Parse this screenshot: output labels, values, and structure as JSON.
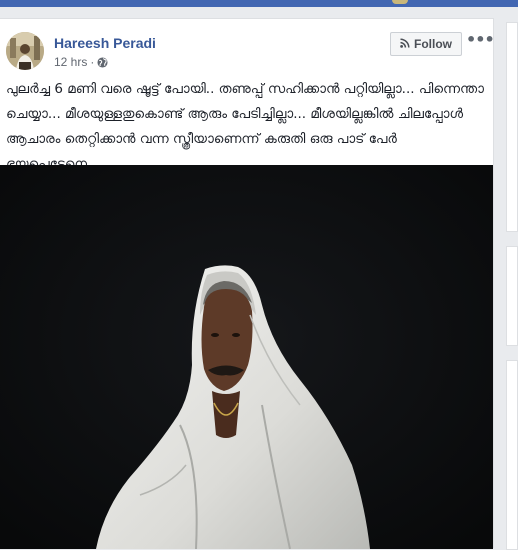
{
  "post": {
    "author": "Hareesh Peradi",
    "timestamp": "12 hrs",
    "separator": "·",
    "privacy_icon": "globe-icon",
    "follow_label": "Follow",
    "follow_icon": "rss-icon",
    "more_icon": "more-dots-icon",
    "more_label": "•••",
    "text": "പുലർച്ച 6 മണി വരെ ഷൂട്ട് പോയി.. തണുപ്പ് സഹിക്കാൻ പറ്റിയില്ലാ... പിന്നെന്താ ചെയ്യാ... മീശയുള്ളതുകൊണ്ട് ആരും പേടിച്ചില്ലാ... മീശയില്ലങ്കിൽ ചിലപ്പോൾ ആചാരം തെറ്റിക്കാൻ വന്ന സ്ത്രീയാണെന്ന് കരുതി ഒരു പാട് പേർ ഭയപ്പെട്ടേനെ...."
  },
  "colors": {
    "top_bar": "#4267b2",
    "author_link": "#385898",
    "text": "#1d2129",
    "meta": "#616770",
    "page_bg": "#e9ebee",
    "photo_bg": "#0d0e10"
  }
}
